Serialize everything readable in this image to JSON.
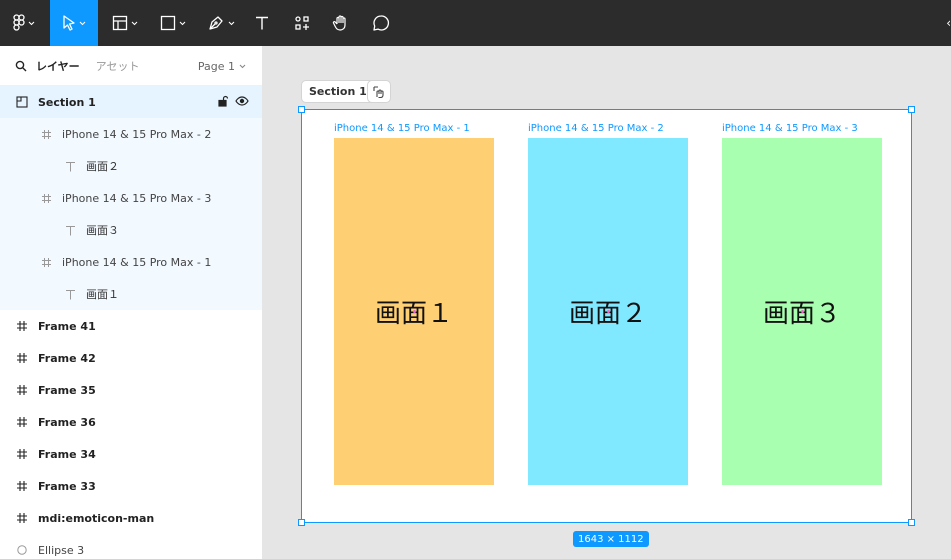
{
  "toolbar": {
    "tools": [
      {
        "name": "main-menu",
        "icon": "figma-logo-icon"
      },
      {
        "name": "move-tool",
        "icon": "cursor-icon",
        "active": true
      },
      {
        "name": "frame-tool",
        "icon": "frame-icon"
      },
      {
        "name": "shape-tool",
        "icon": "rectangle-icon"
      },
      {
        "name": "pen-tool",
        "icon": "pen-icon"
      },
      {
        "name": "text-tool",
        "icon": "text-icon"
      },
      {
        "name": "resources-tool",
        "icon": "components-icon"
      },
      {
        "name": "hand-tool",
        "icon": "hand-icon"
      },
      {
        "name": "comment-tool",
        "icon": "comment-icon"
      }
    ],
    "accent": "#0d99ff"
  },
  "panel": {
    "tabs": {
      "layers": "レイヤー",
      "assets": "アセット"
    },
    "page_label": "Page 1",
    "layers": [
      {
        "label": "Section 1",
        "type": "section",
        "depth": 0,
        "selected": true
      },
      {
        "label": "iPhone 14 & 15 Pro Max - 2",
        "type": "frame",
        "depth": 1
      },
      {
        "label": "画面２",
        "type": "text",
        "depth": 2
      },
      {
        "label": "iPhone 14 & 15 Pro Max - 3",
        "type": "frame",
        "depth": 1
      },
      {
        "label": "画面３",
        "type": "text",
        "depth": 2
      },
      {
        "label": "iPhone 14 & 15 Pro Max - 1",
        "type": "frame",
        "depth": 1
      },
      {
        "label": "画面１",
        "type": "text",
        "depth": 2
      },
      {
        "label": "Frame 41",
        "type": "frame",
        "depth": 0
      },
      {
        "label": "Frame 42",
        "type": "frame",
        "depth": 0
      },
      {
        "label": "Frame 35",
        "type": "frame",
        "depth": 0
      },
      {
        "label": "Frame 36",
        "type": "frame",
        "depth": 0
      },
      {
        "label": "Frame 34",
        "type": "frame",
        "depth": 0
      },
      {
        "label": "Frame 33",
        "type": "frame",
        "depth": 0
      },
      {
        "label": "mdi:emoticon-man",
        "type": "frame",
        "depth": 0
      },
      {
        "label": "Ellipse 3",
        "type": "ellipse",
        "depth": 0
      }
    ]
  },
  "canvas": {
    "section_label": "Section 1",
    "frames": [
      {
        "label": "iPhone 14 & 15 Pro Max - 1",
        "text": "画面１",
        "color": "#ffd073"
      },
      {
        "label": "iPhone 14 & 15 Pro Max - 2",
        "text": "画面２",
        "color": "#80e8ff"
      },
      {
        "label": "iPhone 14 & 15 Pro Max - 3",
        "text": "画面３",
        "color": "#a8ffb0"
      }
    ],
    "dimensions": "1643 × 1112"
  }
}
